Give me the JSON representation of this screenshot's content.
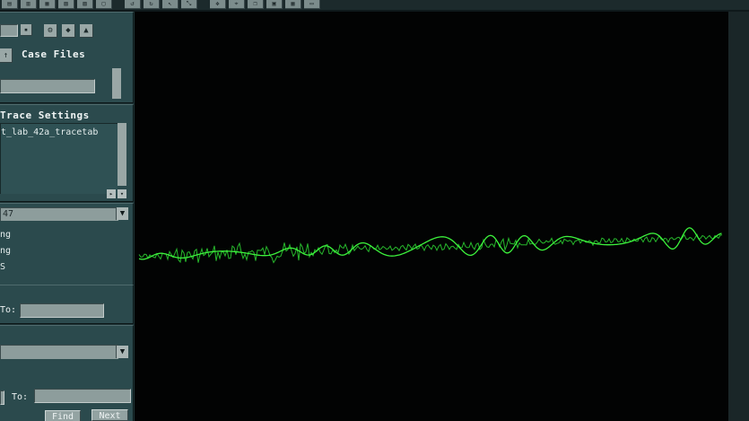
{
  "toolbar": {
    "buttons": [
      {
        "icon": "save-icon",
        "glyph": "▤"
      },
      {
        "icon": "open-icon",
        "glyph": "▥"
      },
      {
        "icon": "import-icon",
        "glyph": "▦"
      },
      {
        "icon": "export-icon",
        "glyph": "▧"
      },
      {
        "icon": "print-icon",
        "glyph": "▨"
      },
      {
        "icon": "page-icon",
        "glyph": "▢"
      },
      {
        "icon": "undo-icon",
        "glyph": "↺"
      },
      {
        "icon": "redo-icon",
        "glyph": "↻"
      },
      {
        "icon": "pointer-icon",
        "glyph": "↖"
      },
      {
        "icon": "zoom-icon",
        "glyph": "⤡"
      },
      {
        "icon": "pan-icon",
        "glyph": "✥"
      },
      {
        "icon": "measure-icon",
        "glyph": "⌖"
      },
      {
        "icon": "copy-icon",
        "glyph": "❐"
      },
      {
        "icon": "paste-icon",
        "glyph": "▣"
      },
      {
        "icon": "grid-icon",
        "glyph": "▦"
      },
      {
        "icon": "display-icon",
        "glyph": "▭"
      }
    ]
  },
  "case_files": {
    "title": "Case Files",
    "up_icon": "↑",
    "icons": [
      "⚙",
      "◆",
      "▲"
    ]
  },
  "trace_settings": {
    "title": "Trace Settings",
    "items": [
      "t_lab_42a_tracetab"
    ]
  },
  "channel": {
    "selected": "47",
    "items": [
      "ng",
      "ng",
      "S"
    ]
  },
  "range": {
    "to_label": "To:"
  },
  "search": {
    "to_label": "To:",
    "find_label": "Find",
    "next_label": "Next"
  },
  "colors": {
    "trace_bright": "#3cf23c",
    "trace_dim": "#27b82c",
    "panel": "#2b4a4d"
  }
}
